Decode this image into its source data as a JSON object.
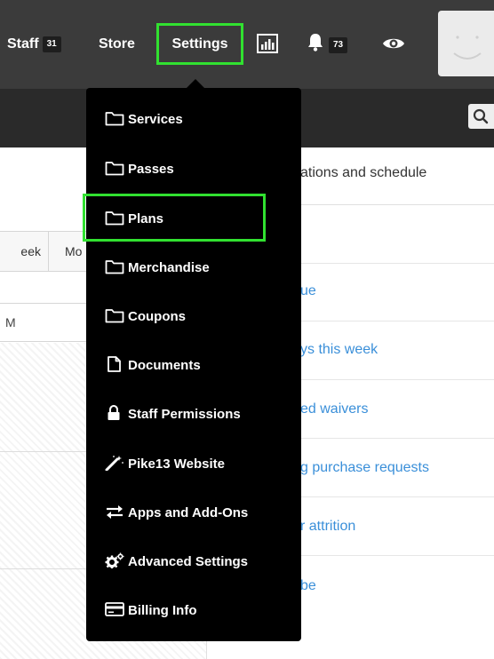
{
  "nav": {
    "staff": {
      "label": "Staff",
      "badge": "31"
    },
    "store": {
      "label": "Store"
    },
    "settings": {
      "label": "Settings"
    },
    "notifications": {
      "badge": "73"
    }
  },
  "background": {
    "section_title": "ations and schedule",
    "view_tabs": [
      "eek",
      "Mo"
    ],
    "column_header": "M",
    "task_links": [
      "ue",
      "ys this week",
      "ed waivers",
      "g purchase requests",
      "r attrition",
      "be"
    ]
  },
  "settings_menu": {
    "items": [
      {
        "label": "Services",
        "icon": "folder-icon"
      },
      {
        "label": "Passes",
        "icon": "folder-icon"
      },
      {
        "label": "Plans",
        "icon": "folder-icon"
      },
      {
        "label": "Merchandise",
        "icon": "folder-icon"
      },
      {
        "label": "Coupons",
        "icon": "folder-icon"
      },
      {
        "label": "Documents",
        "icon": "document-icon"
      },
      {
        "label": "Staff Permissions",
        "icon": "lock-icon"
      },
      {
        "label": "Pike13 Website",
        "icon": "magic-wand-icon"
      },
      {
        "label": "Apps and Add-Ons",
        "icon": "swap-arrows-icon"
      },
      {
        "label": "Advanced Settings",
        "icon": "gears-icon"
      },
      {
        "label": "Billing Info",
        "icon": "credit-card-icon"
      }
    ]
  },
  "colors": {
    "highlight": "#31e130",
    "nav_background": "#3b3b3b",
    "menu_background": "#000000",
    "link": "#3a8fd9"
  }
}
